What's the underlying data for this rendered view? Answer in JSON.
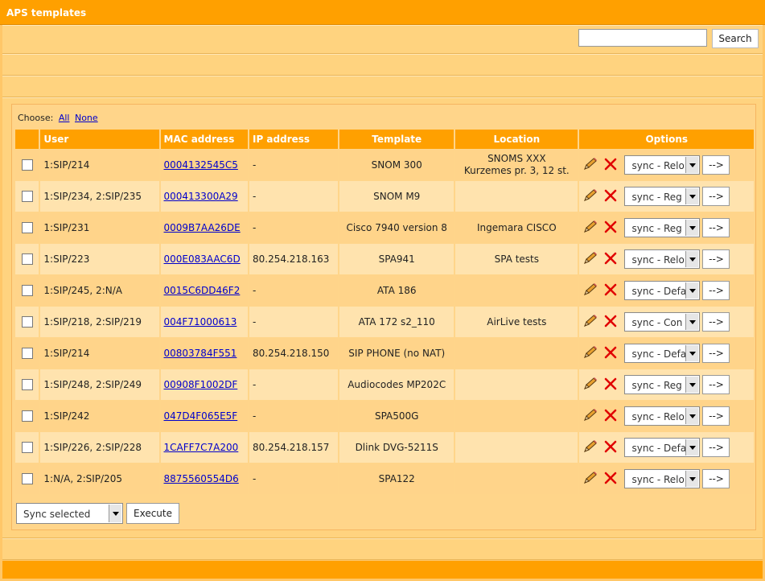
{
  "title": "APS templates",
  "search": {
    "button_label": "Search",
    "value": "",
    "placeholder": ""
  },
  "choose": {
    "label": "Choose:",
    "all": "All",
    "none": "None"
  },
  "columns": [
    "",
    "User",
    "MAC address",
    "IP address",
    "Template",
    "Location",
    "Options"
  ],
  "rows": [
    {
      "user": "1:SIP/214",
      "mac": "0004132545C5",
      "ip": "-",
      "template": "SNOM 300",
      "location1": "SNOMS XXX",
      "location2": "Kurzemes pr. 3, 12 st.",
      "action": "sync - Relo"
    },
    {
      "user": "1:SIP/234, 2:SIP/235",
      "mac": "000413300A29",
      "ip": "-",
      "template": "SNOM M9",
      "location1": "",
      "location2": "",
      "action": "sync - Reg"
    },
    {
      "user": "1:SIP/231",
      "mac": "0009B7AA26DE",
      "ip": "-",
      "template": "Cisco 7940 version 8",
      "location1": "Ingemara CISCO",
      "location2": "",
      "action": "sync - Reg"
    },
    {
      "user": "1:SIP/223",
      "mac": "000E083AAC6D",
      "ip": "80.254.218.163",
      "template": "SPA941",
      "location1": "SPA tests",
      "location2": "",
      "action": "sync - Relo"
    },
    {
      "user": "1:SIP/245, 2:N/A",
      "mac": "0015C6DD46F2",
      "ip": "-",
      "template": "ATA 186",
      "location1": "",
      "location2": "",
      "action": "sync - Defa"
    },
    {
      "user": "1:SIP/218, 2:SIP/219",
      "mac": "004F71000613",
      "ip": "-",
      "template": "ATA 172 s2_110",
      "location1": "AirLive tests",
      "location2": "",
      "action": "sync - Con"
    },
    {
      "user": "1:SIP/214",
      "mac": "00803784F551",
      "ip": "80.254.218.150",
      "template": "SIP PHONE (no NAT)",
      "location1": "",
      "location2": "",
      "action": "sync - Defa"
    },
    {
      "user": "1:SIP/248, 2:SIP/249",
      "mac": "00908F1002DF",
      "ip": "-",
      "template": "Audiocodes MP202C",
      "location1": "",
      "location2": "",
      "action": "sync - Reg"
    },
    {
      "user": "1:SIP/242",
      "mac": "047D4F065E5F",
      "ip": "-",
      "template": "SPA500G",
      "location1": "",
      "location2": "",
      "action": "sync - Relo"
    },
    {
      "user": "1:SIP/226, 2:SIP/228",
      "mac": "1CAFF7C7A200",
      "ip": "80.254.218.157",
      "template": "Dlink DVG-5211S",
      "location1": "",
      "location2": "",
      "action": "sync - Defa"
    },
    {
      "user": "1:N/A, 2:SIP/205",
      "mac": "8875560554D6",
      "ip": "-",
      "template": "SPA122",
      "location1": "",
      "location2": "",
      "action": "sync - Relo"
    }
  ],
  "go_label": "-->",
  "bulk": {
    "selected": "Sync selected",
    "execute_label": "Execute"
  },
  "icons": {
    "edit": "pencil-icon",
    "delete": "delete-x-icon"
  },
  "colors": {
    "header": "#FFA000",
    "link": "#0000CC",
    "delete": "#E00000"
  }
}
